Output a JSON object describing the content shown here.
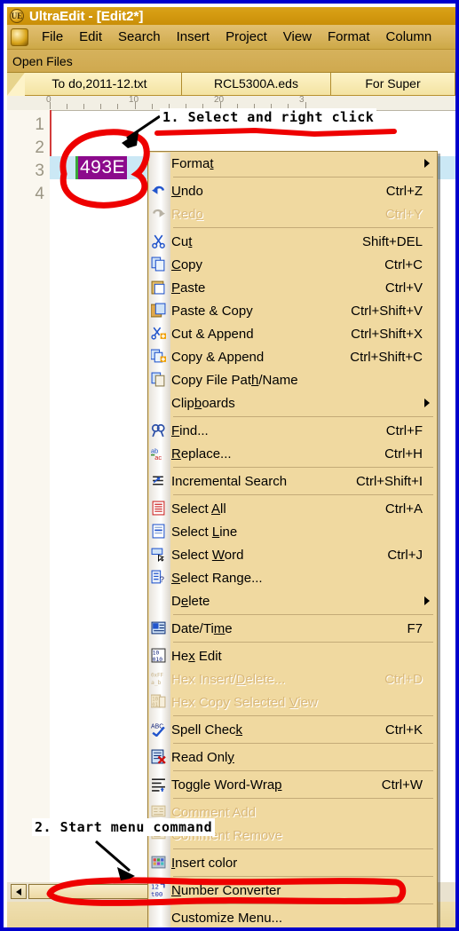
{
  "window": {
    "title": "UltraEdit - [Edit2*]",
    "logo_text": "UE"
  },
  "menubar": {
    "app_icon": "ultraedit-app-icon",
    "items": [
      {
        "label": "File"
      },
      {
        "label": "Edit"
      },
      {
        "label": "Search"
      },
      {
        "label": "Insert"
      },
      {
        "label": "Project"
      },
      {
        "label": "View"
      },
      {
        "label": "Format"
      },
      {
        "label": "Column"
      }
    ]
  },
  "toolbar": {
    "open_files_label": "Open Files"
  },
  "tabs": [
    {
      "label": "To do,2011-12.txt",
      "active": false
    },
    {
      "label": "RCL5300A.eds",
      "active": false
    },
    {
      "label": "For Super",
      "active": false
    }
  ],
  "editor": {
    "ruler_labels": [
      "0",
      "10",
      "20",
      "3"
    ],
    "line_numbers": [
      "1",
      "2",
      "3",
      "4"
    ],
    "selected_text": "493E",
    "selected_line": 3
  },
  "context_menu": {
    "items": [
      {
        "type": "item",
        "icon": "",
        "label": "Forma",
        "label_underline": "t",
        "label_tail": "",
        "accel": "",
        "submenu": true,
        "disabled": false,
        "name": "format"
      },
      {
        "type": "separator"
      },
      {
        "type": "item",
        "icon": "undo-icon",
        "label": "",
        "label_underline": "U",
        "label_tail": "ndo",
        "accel": "Ctrl+Z",
        "submenu": false,
        "disabled": false,
        "name": "undo"
      },
      {
        "type": "item",
        "icon": "redo-icon",
        "label": "Red",
        "label_underline": "o",
        "label_tail": "",
        "accel": "Ctrl+Y",
        "submenu": false,
        "disabled": true,
        "name": "redo"
      },
      {
        "type": "separator"
      },
      {
        "type": "item",
        "icon": "cut-icon",
        "label": "Cu",
        "label_underline": "t",
        "label_tail": "",
        "accel": "Shift+DEL",
        "submenu": false,
        "disabled": false,
        "name": "cut"
      },
      {
        "type": "item",
        "icon": "copy-icon",
        "label": "",
        "label_underline": "C",
        "label_tail": "opy",
        "accel": "Ctrl+C",
        "submenu": false,
        "disabled": false,
        "name": "copy"
      },
      {
        "type": "item",
        "icon": "paste-icon",
        "label": "",
        "label_underline": "P",
        "label_tail": "aste",
        "accel": "Ctrl+V",
        "submenu": false,
        "disabled": false,
        "name": "paste"
      },
      {
        "type": "item",
        "icon": "paste-copy-icon",
        "label": "Paste & Copy",
        "label_underline": "",
        "label_tail": "",
        "accel": "Ctrl+Shift+V",
        "submenu": false,
        "disabled": false,
        "name": "paste-and-copy"
      },
      {
        "type": "item",
        "icon": "cut-append-icon",
        "label": "Cut & Append",
        "label_underline": "",
        "label_tail": "",
        "accel": "Ctrl+Shift+X",
        "submenu": false,
        "disabled": false,
        "name": "cut-and-append"
      },
      {
        "type": "item",
        "icon": "copy-append-icon",
        "label": "Copy & Append",
        "label_underline": "",
        "label_tail": "",
        "accel": "Ctrl+Shift+C",
        "submenu": false,
        "disabled": false,
        "name": "copy-and-append"
      },
      {
        "type": "item",
        "icon": "copy-path-icon",
        "label": "Copy File Pat",
        "label_underline": "h",
        "label_tail": "/Name",
        "accel": "",
        "submenu": false,
        "disabled": false,
        "name": "copy-file-path-name"
      },
      {
        "type": "item",
        "icon": "",
        "label": "Clip",
        "label_underline": "b",
        "label_tail": "oards",
        "accel": "",
        "submenu": true,
        "disabled": false,
        "name": "clipboards"
      },
      {
        "type": "separator"
      },
      {
        "type": "item",
        "icon": "find-icon",
        "label": "",
        "label_underline": "F",
        "label_tail": "ind...",
        "accel": "Ctrl+F",
        "submenu": false,
        "disabled": false,
        "name": "find"
      },
      {
        "type": "item",
        "icon": "replace-icon",
        "label": "",
        "label_underline": "R",
        "label_tail": "eplace...",
        "accel": "Ctrl+H",
        "submenu": false,
        "disabled": false,
        "name": "replace"
      },
      {
        "type": "separator"
      },
      {
        "type": "item",
        "icon": "incremental-search-icon",
        "label": "Incremental Search",
        "label_underline": "",
        "label_tail": "",
        "accel": "Ctrl+Shift+I",
        "submenu": false,
        "disabled": false,
        "name": "incremental-search"
      },
      {
        "type": "separator"
      },
      {
        "type": "item",
        "icon": "select-all-icon",
        "label": "Select ",
        "label_underline": "A",
        "label_tail": "ll",
        "accel": "Ctrl+A",
        "submenu": false,
        "disabled": false,
        "name": "select-all"
      },
      {
        "type": "item",
        "icon": "select-line-icon",
        "label": "Select ",
        "label_underline": "L",
        "label_tail": "ine",
        "accel": "",
        "submenu": false,
        "disabled": false,
        "name": "select-line"
      },
      {
        "type": "item",
        "icon": "select-word-icon",
        "label": "Select ",
        "label_underline": "W",
        "label_tail": "ord",
        "accel": "Ctrl+J",
        "submenu": false,
        "disabled": false,
        "name": "select-word"
      },
      {
        "type": "item",
        "icon": "select-range-icon",
        "label": "",
        "label_underline": "S",
        "label_tail": "elect Range...",
        "accel": "",
        "submenu": false,
        "disabled": false,
        "name": "select-range"
      },
      {
        "type": "item",
        "icon": "",
        "label": "D",
        "label_underline": "e",
        "label_tail": "lete",
        "accel": "",
        "submenu": true,
        "disabled": false,
        "name": "delete"
      },
      {
        "type": "separator"
      },
      {
        "type": "item",
        "icon": "datetime-icon",
        "label": "Date/Ti",
        "label_underline": "m",
        "label_tail": "e",
        "accel": "F7",
        "submenu": false,
        "disabled": false,
        "name": "date-time"
      },
      {
        "type": "separator"
      },
      {
        "type": "item",
        "icon": "hex-edit-icon",
        "label": "He",
        "label_underline": "x",
        "label_tail": " Edit",
        "accel": "",
        "submenu": false,
        "disabled": false,
        "name": "hex-edit"
      },
      {
        "type": "item",
        "icon": "hex-insert-icon",
        "label": "Hex Insert/",
        "label_underline": "D",
        "label_tail": "elete...",
        "accel": "Ctrl+D",
        "submenu": false,
        "disabled": true,
        "name": "hex-insert-delete"
      },
      {
        "type": "item",
        "icon": "hex-copy-icon",
        "label": "Hex Copy Selected ",
        "label_underline": "V",
        "label_tail": "iew",
        "accel": "",
        "submenu": false,
        "disabled": true,
        "name": "hex-copy-selected-view"
      },
      {
        "type": "separator"
      },
      {
        "type": "item",
        "icon": "spell-check-icon",
        "label": "Spell Chec",
        "label_underline": "k",
        "label_tail": "",
        "accel": "Ctrl+K",
        "submenu": false,
        "disabled": false,
        "name": "spell-check"
      },
      {
        "type": "separator"
      },
      {
        "type": "item",
        "icon": "read-only-icon",
        "label": "Read Onl",
        "label_underline": "y",
        "label_tail": "",
        "accel": "",
        "submenu": false,
        "disabled": false,
        "name": "read-only"
      },
      {
        "type": "separator"
      },
      {
        "type": "item",
        "icon": "word-wrap-icon",
        "label": "Toggle Word-Wra",
        "label_underline": "p",
        "label_tail": "",
        "accel": "Ctrl+W",
        "submenu": false,
        "disabled": false,
        "name": "toggle-word-wrap"
      },
      {
        "type": "separator"
      },
      {
        "type": "item",
        "icon": "comment-add-icon",
        "label": "Comment Add",
        "label_underline": "",
        "label_tail": "",
        "accel": "",
        "submenu": false,
        "disabled": true,
        "name": "comment-add"
      },
      {
        "type": "item",
        "icon": "comment-remove-icon",
        "label": "Comment Remove",
        "label_underline": "",
        "label_tail": "",
        "accel": "",
        "submenu": false,
        "disabled": true,
        "name": "comment-remove"
      },
      {
        "type": "separator"
      },
      {
        "type": "item",
        "icon": "insert-color-icon",
        "label": "",
        "label_underline": "I",
        "label_tail": "nsert color",
        "accel": "",
        "submenu": false,
        "disabled": false,
        "name": "insert-color"
      },
      {
        "type": "separator"
      },
      {
        "type": "item",
        "icon": "number-converter-icon",
        "label": "",
        "label_underline": "N",
        "label_tail": "umber Converter",
        "accel": "",
        "submenu": false,
        "disabled": false,
        "name": "number-converter"
      },
      {
        "type": "separator"
      },
      {
        "type": "item",
        "icon": "",
        "label": "Customize Menu...",
        "label_underline": "",
        "label_tail": "",
        "accel": "",
        "submenu": false,
        "disabled": false,
        "name": "customize-menu"
      }
    ]
  },
  "annotations": [
    {
      "text": "1. Select and right click",
      "name": "annotation-step-1"
    },
    {
      "text": "2. Start menu command",
      "name": "annotation-step-2"
    }
  ],
  "colors": {
    "annotation_red": "#ee0000",
    "selection_purple": "#8c0a8c",
    "active_line_blue": "#cbe8f5",
    "window_border_blue": "#0000cc",
    "menu_background": "#f0d9a0"
  }
}
